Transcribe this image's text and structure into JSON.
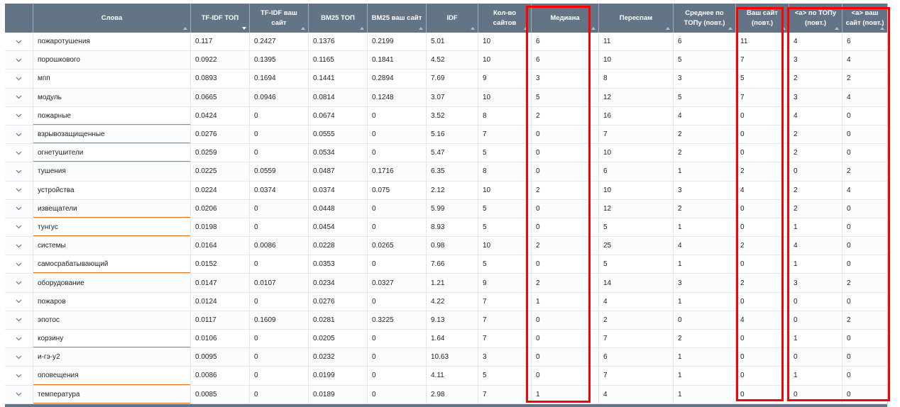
{
  "table": {
    "columns": [
      {
        "key": "expand",
        "label": "",
        "width": 40
      },
      {
        "key": "word",
        "label": "Слова",
        "width": 222
      },
      {
        "key": "tfidf_top",
        "label": "TF-IDF ТОП",
        "width": 83
      },
      {
        "key": "tfidf_site",
        "label": "TF-IDF ваш сайт",
        "width": 83
      },
      {
        "key": "bm25_top",
        "label": "BM25 ТОП",
        "width": 83
      },
      {
        "key": "bm25_site",
        "label": "BM25 ваш сайт",
        "width": 83
      },
      {
        "key": "idf",
        "label": "IDF",
        "width": 73
      },
      {
        "key": "sites",
        "label": "Кол-во сайтов",
        "width": 75
      },
      {
        "key": "median",
        "label": "Медиана",
        "width": 95
      },
      {
        "key": "overspam",
        "label": "Переспам",
        "width": 105
      },
      {
        "key": "avg_top",
        "label": "Среднее по ТОПу (повт.)",
        "width": 88
      },
      {
        "key": "your_site",
        "label": "Ваш сайт (повт.)",
        "width": 75
      },
      {
        "key": "a_top",
        "label": "<a> по ТОПу (повт.)",
        "width": 75
      },
      {
        "key": "a_site",
        "label": "<a> ваш сайт (повт.)",
        "width": 63
      }
    ],
    "sort": {
      "column": "tfidf_top",
      "direction": "desc"
    },
    "rows": [
      {
        "word": "пожаротушения",
        "tfidf_top": "0.117",
        "tfidf_site": "0.2427",
        "bm25_top": "0.1376",
        "bm25_site": "0.2199",
        "idf": "5.01",
        "sites": "10",
        "median": "6",
        "overspam": "11",
        "avg_top": "6",
        "your_site": "11",
        "a_top": "4",
        "a_site": "6",
        "flag": false
      },
      {
        "word": "порошкового",
        "tfidf_top": "0.0922",
        "tfidf_site": "0.1395",
        "bm25_top": "0.1165",
        "bm25_site": "0.1841",
        "idf": "4.52",
        "sites": "10",
        "median": "6",
        "overspam": "10",
        "avg_top": "5",
        "your_site": "7",
        "a_top": "3",
        "a_site": "4",
        "flag": false
      },
      {
        "word": "мпп",
        "tfidf_top": "0.0893",
        "tfidf_site": "0.1694",
        "bm25_top": "0.1441",
        "bm25_site": "0.2894",
        "idf": "7.69",
        "sites": "9",
        "median": "3",
        "overspam": "8",
        "avg_top": "3",
        "your_site": "5",
        "a_top": "2",
        "a_site": "2",
        "flag": false
      },
      {
        "word": "модуль",
        "tfidf_top": "0.0665",
        "tfidf_site": "0.0946",
        "bm25_top": "0.0814",
        "bm25_site": "0.1248",
        "idf": "3.07",
        "sites": "10",
        "median": "5",
        "overspam": "12",
        "avg_top": "5",
        "your_site": "7",
        "a_top": "3",
        "a_site": "4",
        "flag": false
      },
      {
        "word": "пожарные",
        "tfidf_top": "0.0424",
        "tfidf_site": "0",
        "bm25_top": "0.0674",
        "bm25_site": "0",
        "idf": "3.52",
        "sites": "8",
        "median": "2",
        "overspam": "16",
        "avg_top": "4",
        "your_site": "0",
        "a_top": "4",
        "a_site": "0",
        "flag": true
      },
      {
        "word": "взрывозащищенные",
        "tfidf_top": "0.0276",
        "tfidf_site": "0",
        "bm25_top": "0.0555",
        "bm25_site": "0",
        "idf": "5.16",
        "sites": "7",
        "median": "0",
        "overspam": "7",
        "avg_top": "2",
        "your_site": "0",
        "a_top": "2",
        "a_site": "0",
        "flag": true
      },
      {
        "word": "огнетушители",
        "tfidf_top": "0.0259",
        "tfidf_site": "0",
        "bm25_top": "0.0534",
        "bm25_site": "0",
        "idf": "5.47",
        "sites": "5",
        "median": "0",
        "overspam": "10",
        "avg_top": "2",
        "your_site": "0",
        "a_top": "2",
        "a_site": "0",
        "flag": true
      },
      {
        "word": "тушения",
        "tfidf_top": "0.0225",
        "tfidf_site": "0.0559",
        "bm25_top": "0.0487",
        "bm25_site": "0.1716",
        "idf": "6.35",
        "sites": "8",
        "median": "0",
        "overspam": "6",
        "avg_top": "1",
        "your_site": "2",
        "a_top": "0",
        "a_site": "2",
        "flag": false
      },
      {
        "word": "устройства",
        "tfidf_top": "0.0224",
        "tfidf_site": "0.0374",
        "bm25_top": "0.0374",
        "bm25_site": "0.075",
        "idf": "2.12",
        "sites": "10",
        "median": "2",
        "overspam": "10",
        "avg_top": "3",
        "your_site": "4",
        "a_top": "2",
        "a_site": "4",
        "flag": false
      },
      {
        "word": "извещатели",
        "tfidf_top": "0.0206",
        "tfidf_site": "0",
        "bm25_top": "0.0448",
        "bm25_site": "0",
        "idf": "5.99",
        "sites": "5",
        "median": "0",
        "overspam": "12",
        "avg_top": "2",
        "your_site": "0",
        "a_top": "2",
        "a_site": "0",
        "flag": true
      },
      {
        "word": "тунгус",
        "tfidf_top": "0.0198",
        "tfidf_site": "0",
        "bm25_top": "0.0454",
        "bm25_site": "0",
        "idf": "8.93",
        "sites": "5",
        "median": "0",
        "overspam": "5",
        "avg_top": "1",
        "your_site": "0",
        "a_top": "1",
        "a_site": "0",
        "flag": true
      },
      {
        "word": "системы",
        "tfidf_top": "0.0164",
        "tfidf_site": "0.0086",
        "bm25_top": "0.0228",
        "bm25_site": "0.0265",
        "idf": "0.98",
        "sites": "10",
        "median": "2",
        "overspam": "25",
        "avg_top": "4",
        "your_site": "2",
        "a_top": "4",
        "a_site": "0",
        "flag": false
      },
      {
        "word": "самосрабатывающий",
        "tfidf_top": "0.0152",
        "tfidf_site": "0",
        "bm25_top": "0.0353",
        "bm25_site": "0",
        "idf": "7.66",
        "sites": "5",
        "median": "0",
        "overspam": "5",
        "avg_top": "1",
        "your_site": "0",
        "a_top": "1",
        "a_site": "0",
        "flag": true
      },
      {
        "word": "оборудование",
        "tfidf_top": "0.0147",
        "tfidf_site": "0.0107",
        "bm25_top": "0.0234",
        "bm25_site": "0.0327",
        "idf": "1.21",
        "sites": "9",
        "median": "2",
        "overspam": "14",
        "avg_top": "3",
        "your_site": "2",
        "a_top": "3",
        "a_site": "2",
        "flag": false
      },
      {
        "word": "пожаров",
        "tfidf_top": "0.0124",
        "tfidf_site": "0",
        "bm25_top": "0.0276",
        "bm25_site": "0",
        "idf": "4.22",
        "sites": "7",
        "median": "1",
        "overspam": "4",
        "avg_top": "1",
        "your_site": "0",
        "a_top": "0",
        "a_site": "0",
        "flag": false
      },
      {
        "word": "эпотос",
        "tfidf_top": "0.0117",
        "tfidf_site": "0.1609",
        "bm25_top": "0.0281",
        "bm25_site": "0.3225",
        "idf": "9.13",
        "sites": "7",
        "median": "0",
        "overspam": "2",
        "avg_top": "0",
        "your_site": "4",
        "a_top": "0",
        "a_site": "2",
        "flag": false
      },
      {
        "word": "корзину",
        "tfidf_top": "0.0106",
        "tfidf_site": "0",
        "bm25_top": "0.0205",
        "bm25_site": "0",
        "idf": "1.64",
        "sites": "7",
        "median": "0",
        "overspam": "7",
        "avg_top": "2",
        "your_site": "0",
        "a_top": "1",
        "a_site": "0",
        "flag": true
      },
      {
        "word": "и-гэ-у2",
        "tfidf_top": "0.0095",
        "tfidf_site": "0",
        "bm25_top": "0.0232",
        "bm25_site": "0",
        "idf": "10.63",
        "sites": "3",
        "median": "0",
        "overspam": "6",
        "avg_top": "1",
        "your_site": "0",
        "a_top": "0",
        "a_site": "0",
        "flag": false
      },
      {
        "word": "оповещения",
        "tfidf_top": "0.0086",
        "tfidf_site": "0",
        "bm25_top": "0.0199",
        "bm25_site": "0",
        "idf": "4.11",
        "sites": "5",
        "median": "0",
        "overspam": "7",
        "avg_top": "1",
        "your_site": "0",
        "a_top": "1",
        "a_site": "0",
        "flag": true
      },
      {
        "word": "температура",
        "tfidf_top": "0.0085",
        "tfidf_site": "0",
        "bm25_top": "0.0189",
        "bm25_site": "0",
        "idf": "2.98",
        "sites": "7",
        "median": "1",
        "overspam": "4",
        "avg_top": "1",
        "your_site": "0",
        "a_top": "0",
        "a_site": "0",
        "flag": true
      }
    ],
    "expand_icon": "chevron-down-icon",
    "colors": {
      "header_bg": "#627486",
      "flag_underline": "#e8731f",
      "highlight": "#ff0000"
    }
  }
}
